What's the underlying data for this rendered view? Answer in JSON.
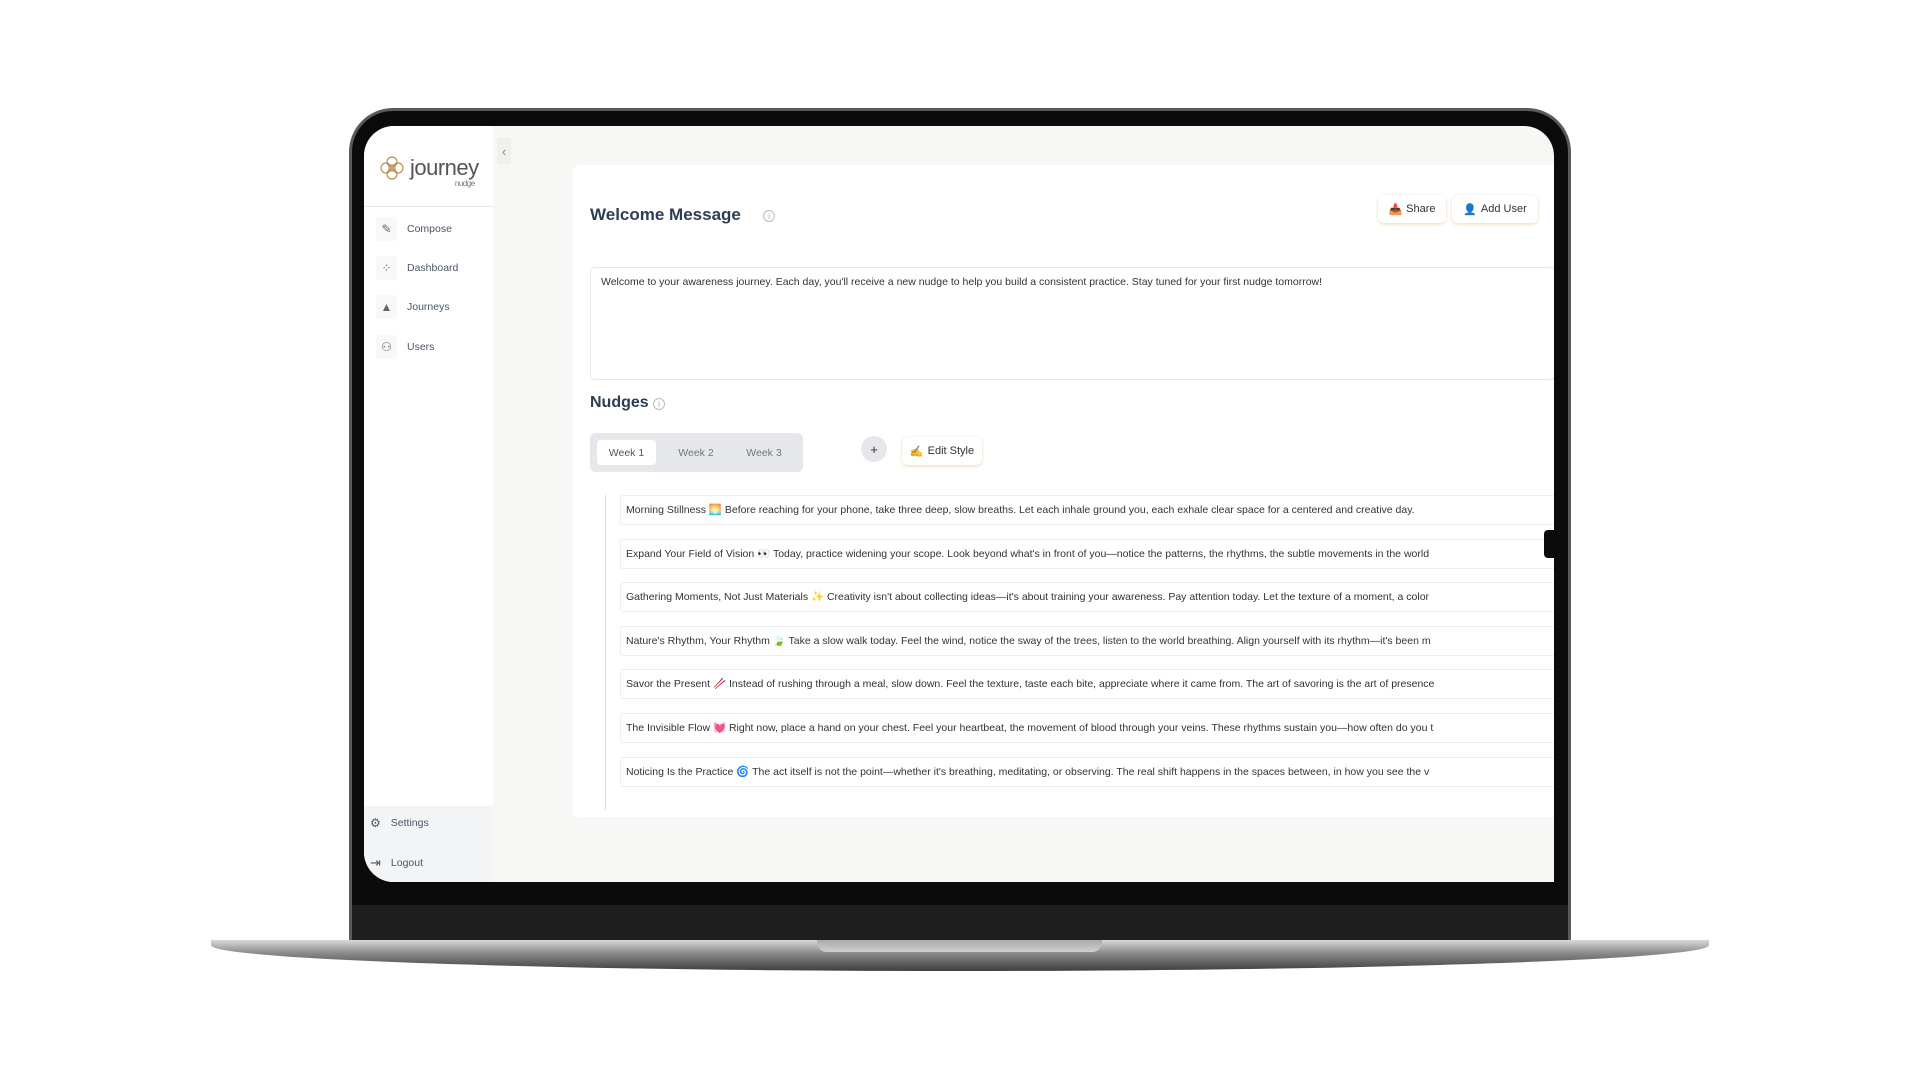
{
  "brand": {
    "name": "journey",
    "tagline": "nudge"
  },
  "sidebar": {
    "items": [
      {
        "label": "Compose",
        "icon": "compose-icon"
      },
      {
        "label": "Dashboard",
        "icon": "dashboard-icon"
      },
      {
        "label": "Journeys",
        "icon": "journeys-icon"
      },
      {
        "label": "Users",
        "icon": "users-icon"
      }
    ],
    "bottom": [
      {
        "label": "Settings",
        "icon": "settings-icon"
      },
      {
        "label": "Logout",
        "icon": "logout-icon"
      }
    ]
  },
  "welcome": {
    "title": "Welcome Message",
    "message": "Welcome to your awareness journey. Each day, you'll receive a new nudge to help you build a consistent practice. Stay tuned for your first nudge tomorrow!"
  },
  "actions": {
    "share": "Share",
    "add_user": "Add User"
  },
  "nudges": {
    "title": "Nudges",
    "tabs": [
      "Week 1",
      "Week 2",
      "Week 3"
    ],
    "active_tab": "Week 1",
    "add": "+",
    "edit_style": "Edit Style",
    "items": [
      "Morning Stillness 🌅 Before reaching for your phone, take three deep, slow breaths. Let each inhale ground you, each exhale clear space for a centered and creative day.",
      "Expand Your Field of Vision 👀 Today, practice widening your scope. Look beyond what's in front of you—notice the patterns, the rhythms, the subtle movements in the world",
      "Gathering Moments, Not Just Materials ✨ Creativity isn't about collecting ideas—it's about training your awareness. Pay attention today. Let the texture of a moment, a color",
      "Nature's Rhythm, Your Rhythm 🍃 Take a slow walk today. Feel the wind, notice the sway of the trees, listen to the world breathing. Align yourself with its rhythm—it's been m",
      "Savor the Present 🥢 Instead of rushing through a meal, slow down. Feel the texture, taste each bite, appreciate where it came from. The art of savoring is the art of presence",
      "The Invisible Flow 💓 Right now, place a hand on your chest. Feel your heartbeat, the movement of blood through your veins. These rhythms sustain you—how often do you t",
      "Noticing Is the Practice 🌀 The act itself is not the point—whether it's breathing, meditating, or observing. The real shift happens in the spaces between, in how you see the v"
    ]
  },
  "colors": {
    "accent": "#2d3e50",
    "logo": "#b8905a"
  }
}
